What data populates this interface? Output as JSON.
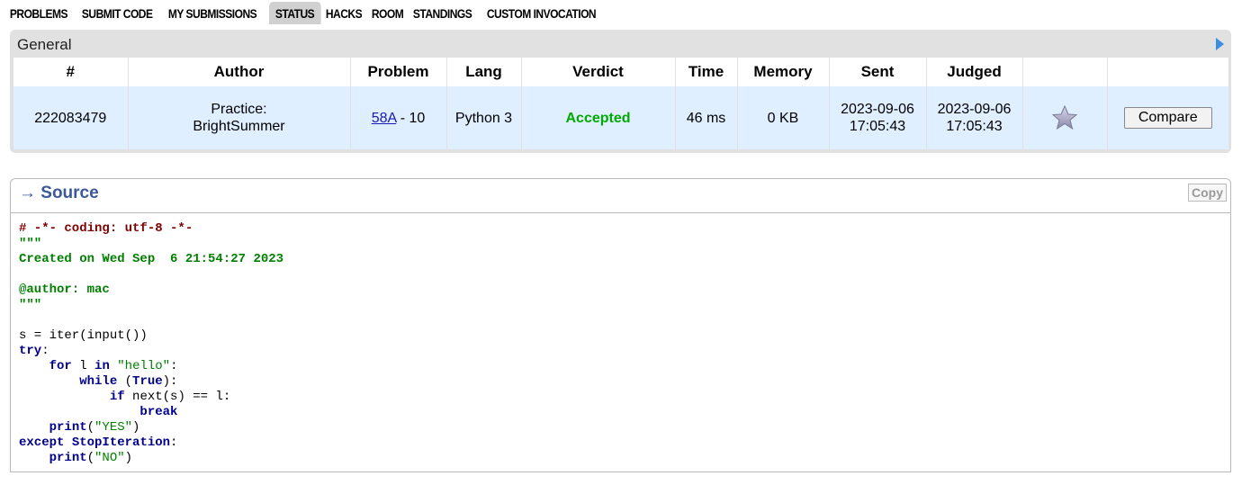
{
  "nav": {
    "items": [
      {
        "label": "Problems",
        "active": false
      },
      {
        "label": "Submit Code",
        "active": false
      },
      {
        "label": "My Submissions",
        "active": false
      },
      {
        "label": "Status",
        "active": true
      },
      {
        "label": "Hacks",
        "active": false
      },
      {
        "label": "Room",
        "active": false
      },
      {
        "label": "Standings",
        "active": false
      },
      {
        "label": "Custom Invocation",
        "active": false
      }
    ]
  },
  "general": {
    "title": "General",
    "columns": [
      "#",
      "Author",
      "Problem",
      "Lang",
      "Verdict",
      "Time",
      "Memory",
      "Sent",
      "Judged",
      "",
      ""
    ],
    "row": {
      "id": "222083479",
      "author_line1": "Practice:",
      "author_line2": "BrightSummer",
      "problem_link": "58A",
      "problem_rest": " - 10",
      "lang": "Python 3",
      "verdict": "Accepted",
      "time": "46 ms",
      "memory": "0 KB",
      "sent": "2023-09-06 17:05:43",
      "judged": "2023-09-06 17:05:43",
      "compare_label": "Compare"
    },
    "colors": {
      "verdict": "#00aa00",
      "row_bg": "#dfefff",
      "link": "#1a1ab0"
    }
  },
  "source": {
    "title": "→ Source",
    "copy_label": "Copy",
    "lines": {
      "l1": "# -*- coding: utf-8 -*-",
      "l2": "\"\"\"",
      "l3": "Created on Wed Sep  6 21:54:27 2023",
      "l4": "",
      "l5": "@author: mac",
      "l6": "\"\"\"",
      "l7": "",
      "l8a": "s = iter(input())",
      "l9a": "try",
      "l9b": ":",
      "l10a": "for",
      "l10b": " l ",
      "l10c": "in",
      "l10d": "\"hello\"",
      "l10e": ":",
      "l11a": "while",
      "l11b": " (",
      "l11c": "True",
      "l11d": "):",
      "l12a": "if",
      "l12b": " next(s) == l:",
      "l13a": "break",
      "l14a": "print",
      "l14b": "(",
      "l14c": "\"YES\"",
      "l14d": ")",
      "l15a": "except",
      "l15b": "StopIteration",
      "l15c": ":",
      "l16a": "print",
      "l16b": "(",
      "l16c": "\"NO\"",
      "l16d": ")"
    }
  }
}
